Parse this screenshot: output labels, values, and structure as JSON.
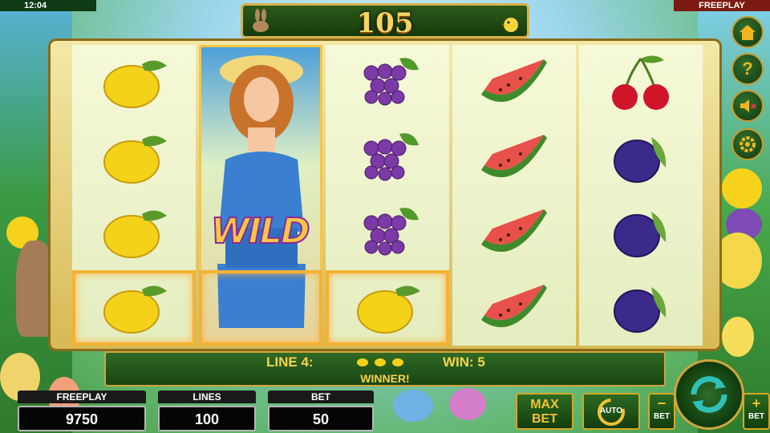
{
  "status_bar": {
    "clock": "12:04",
    "mode": "FREEPLAY"
  },
  "banner": {
    "win_amount": "105"
  },
  "reels": [
    [
      "lemon",
      "lemon",
      "lemon",
      "lemon"
    ],
    [
      "wild",
      "wild",
      "wild",
      "wild"
    ],
    [
      "grapes",
      "grapes",
      "grapes",
      "lemon"
    ],
    [
      "watermelon",
      "watermelon",
      "watermelon",
      "watermelon"
    ],
    [
      "cherries",
      "plum",
      "plum",
      "plum"
    ]
  ],
  "wild_label": "WILD",
  "highlighted_row": 4,
  "info": {
    "line_label": "LINE 4:",
    "win_label": "WIN: 5",
    "winner_label": "WINNER!",
    "line_symbols": [
      "lemon",
      "lemon",
      "lemon"
    ]
  },
  "stats": {
    "freeplay": {
      "label": "FREEPLAY",
      "value": "9750"
    },
    "lines": {
      "label": "LINES",
      "value": "100"
    },
    "bet": {
      "label": "BET",
      "value": "50"
    }
  },
  "buttons": {
    "max_bet": [
      "MAX",
      "BET"
    ],
    "auto": "AUTO",
    "bet_minus": "BET",
    "bet_plus": "BET"
  },
  "side_menu": [
    "home-icon",
    "help-icon",
    "sound-off-icon",
    "settings-icon"
  ],
  "colors": {
    "accent_gold": "#f7d24a",
    "panel_green": "#1a4412"
  }
}
